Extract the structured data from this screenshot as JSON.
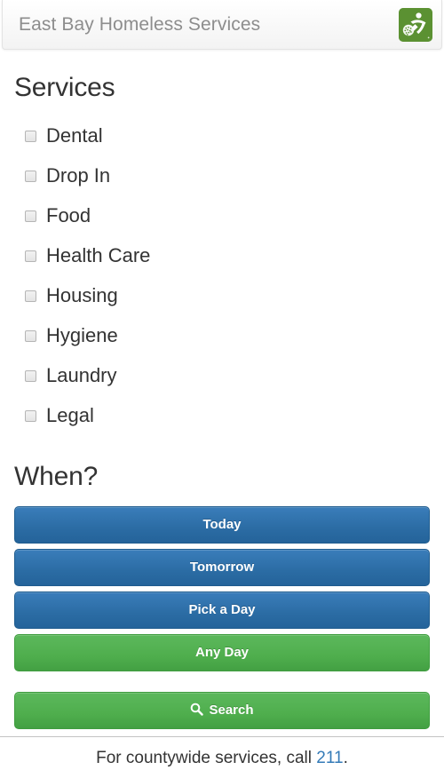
{
  "header": {
    "title": "East Bay Homeless Services",
    "logo_icon": "person-running-logo",
    "logo_color": "#5b9132"
  },
  "services": {
    "heading": "Services",
    "items": [
      {
        "label": "Dental",
        "checked": false
      },
      {
        "label": "Drop In",
        "checked": false
      },
      {
        "label": "Food",
        "checked": false
      },
      {
        "label": "Health Care",
        "checked": false
      },
      {
        "label": "Housing",
        "checked": false
      },
      {
        "label": "Hygiene",
        "checked": false
      },
      {
        "label": "Laundry",
        "checked": false
      },
      {
        "label": "Legal",
        "checked": false
      }
    ]
  },
  "when": {
    "heading": "When?",
    "buttons": [
      {
        "label": "Today",
        "style": "primary",
        "selected": false
      },
      {
        "label": "Tomorrow",
        "style": "primary",
        "selected": false
      },
      {
        "label": "Pick a Day",
        "style": "primary",
        "selected": false
      },
      {
        "label": "Any Day",
        "style": "success",
        "selected": true
      }
    ]
  },
  "search": {
    "label": "Search",
    "icon": "search-icon"
  },
  "footer": {
    "text_before": "For countywide services, call ",
    "link_text": "211",
    "text_after": "."
  },
  "colors": {
    "primary": "#2b6ca4",
    "success": "#4fae4d",
    "link": "#337ab7",
    "brand_green": "#5b9132"
  }
}
